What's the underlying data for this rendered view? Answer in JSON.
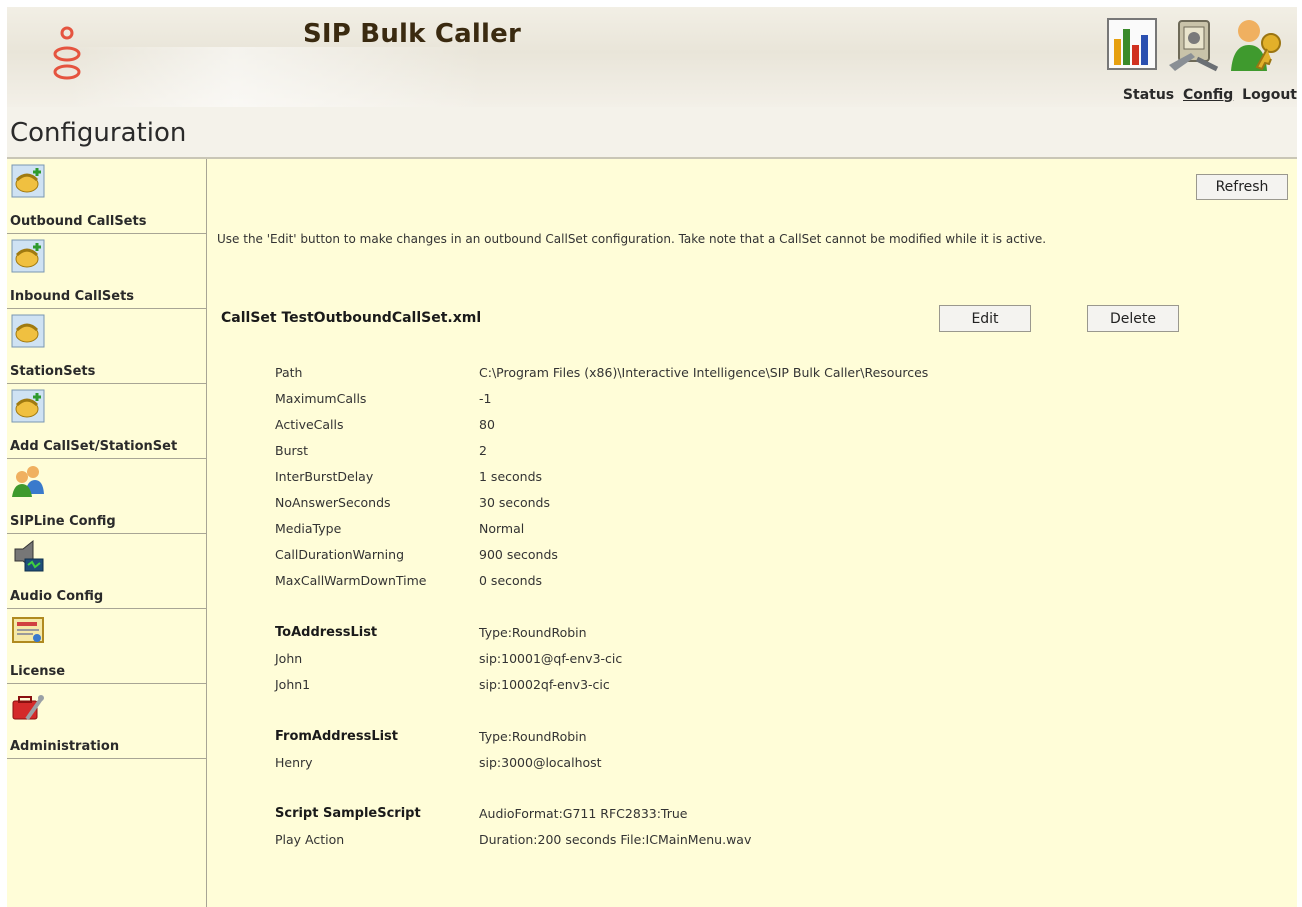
{
  "header": {
    "app_title": "SIP Bulk Caller",
    "nav": {
      "status": "Status",
      "config": "Config",
      "logout": "Logout"
    }
  },
  "page_title": "Configuration",
  "sidebar": {
    "items": [
      {
        "label": "Outbound CallSets",
        "icon": "phone-add-icon"
      },
      {
        "label": "Inbound CallSets",
        "icon": "phone-add-icon"
      },
      {
        "label": "StationSets",
        "icon": "phone-icon"
      },
      {
        "label": "Add CallSet/StationSet",
        "icon": "phone-add-icon"
      },
      {
        "label": "SIPLine Config",
        "icon": "users-icon"
      },
      {
        "label": "Audio Config",
        "icon": "speaker-icon"
      },
      {
        "label": "License",
        "icon": "certificate-icon"
      },
      {
        "label": "Administration",
        "icon": "toolbox-icon"
      }
    ]
  },
  "main": {
    "refresh_label": "Refresh",
    "intro": "Use the 'Edit' button to make changes in an outbound CallSet configuration. Take note that a CallSet cannot be modified while it is active.",
    "callset_title": "CallSet TestOutboundCallSet.xml",
    "edit_label": "Edit",
    "delete_label": "Delete",
    "properties": [
      {
        "key": "Path",
        "value": "C:\\Program Files (x86)\\Interactive Intelligence\\SIP Bulk Caller\\Resources"
      },
      {
        "key": "MaximumCalls",
        "value": "-1"
      },
      {
        "key": "ActiveCalls",
        "value": "80"
      },
      {
        "key": "Burst",
        "value": "2"
      },
      {
        "key": "InterBurstDelay",
        "value": "1 seconds"
      },
      {
        "key": "NoAnswerSeconds",
        "value": "30 seconds"
      },
      {
        "key": "MediaType",
        "value": "Normal"
      },
      {
        "key": "CallDurationWarning",
        "value": "900 seconds"
      },
      {
        "key": "MaxCallWarmDownTime",
        "value": "0 seconds"
      }
    ],
    "to_address": {
      "heading": "ToAddressList",
      "type": "Type:RoundRobin",
      "entries": [
        {
          "name": "John",
          "address": "sip:10001@qf-env3-cic"
        },
        {
          "name": "John1",
          "address": "sip:10002qf-env3-cic"
        }
      ]
    },
    "from_address": {
      "heading": "FromAddressList",
      "type": "Type:RoundRobin",
      "entries": [
        {
          "name": "Henry",
          "address": "sip:3000@localhost"
        }
      ]
    },
    "script": {
      "heading": "Script SampleScript",
      "info": "AudioFormat:G711 RFC2833:True",
      "actions": [
        {
          "name": "Play Action",
          "detail": "Duration:200 seconds File:ICMainMenu.wav"
        }
      ]
    }
  },
  "colors": {
    "content_bg": "#fffdd8",
    "logo": "#e5543f",
    "header_bg": "#ece9dd"
  }
}
